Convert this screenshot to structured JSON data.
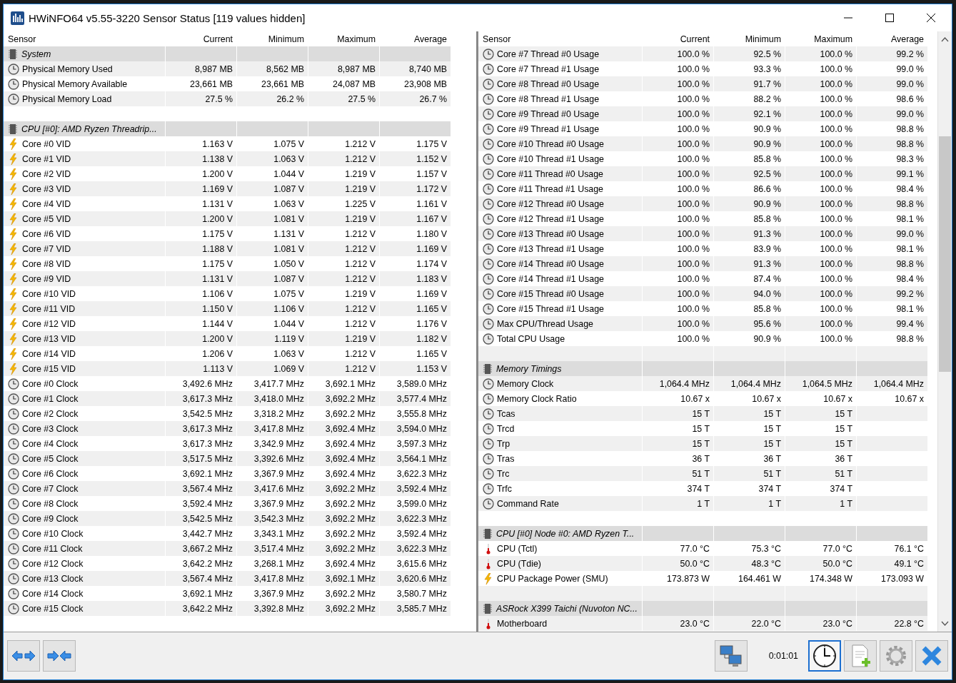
{
  "window": {
    "title": "HWiNFO64 v5.55-3220 Sensor Status [119 values hidden]"
  },
  "panes": [
    {
      "columns": [
        "Sensor",
        "Current",
        "Minimum",
        "Maximum",
        "Average"
      ],
      "first_row_shaded": false,
      "rows": [
        {
          "kind": "group",
          "label": "System"
        },
        {
          "kind": "clock",
          "label": "Physical Memory Used",
          "values": [
            "8,987 MB",
            "8,562 MB",
            "8,987 MB",
            "8,740 MB"
          ]
        },
        {
          "kind": "clock",
          "label": "Physical Memory Available",
          "values": [
            "23,661 MB",
            "23,661 MB",
            "24,087 MB",
            "23,908 MB"
          ]
        },
        {
          "kind": "clock",
          "label": "Physical Memory Load",
          "values": [
            "27.5 %",
            "26.2 %",
            "27.5 %",
            "26.7 %"
          ]
        },
        {
          "kind": "blank"
        },
        {
          "kind": "group",
          "label": "CPU [#0]: AMD Ryzen Threadrip..."
        },
        {
          "kind": "volt",
          "label": "Core #0 VID",
          "values": [
            "1.163 V",
            "1.075 V",
            "1.212 V",
            "1.175 V"
          ]
        },
        {
          "kind": "volt",
          "label": "Core #1 VID",
          "values": [
            "1.138 V",
            "1.063 V",
            "1.212 V",
            "1.152 V"
          ]
        },
        {
          "kind": "volt",
          "label": "Core #2 VID",
          "values": [
            "1.200 V",
            "1.044 V",
            "1.219 V",
            "1.157 V"
          ]
        },
        {
          "kind": "volt",
          "label": "Core #3 VID",
          "values": [
            "1.169 V",
            "1.087 V",
            "1.219 V",
            "1.172 V"
          ]
        },
        {
          "kind": "volt",
          "label": "Core #4 VID",
          "values": [
            "1.131 V",
            "1.063 V",
            "1.225 V",
            "1.161 V"
          ]
        },
        {
          "kind": "volt",
          "label": "Core #5 VID",
          "values": [
            "1.200 V",
            "1.081 V",
            "1.219 V",
            "1.167 V"
          ]
        },
        {
          "kind": "volt",
          "label": "Core #6 VID",
          "values": [
            "1.175 V",
            "1.131 V",
            "1.212 V",
            "1.180 V"
          ]
        },
        {
          "kind": "volt",
          "label": "Core #7 VID",
          "values": [
            "1.188 V",
            "1.081 V",
            "1.212 V",
            "1.169 V"
          ]
        },
        {
          "kind": "volt",
          "label": "Core #8 VID",
          "values": [
            "1.175 V",
            "1.050 V",
            "1.212 V",
            "1.174 V"
          ]
        },
        {
          "kind": "volt",
          "label": "Core #9 VID",
          "values": [
            "1.131 V",
            "1.087 V",
            "1.212 V",
            "1.183 V"
          ]
        },
        {
          "kind": "volt",
          "label": "Core #10 VID",
          "values": [
            "1.106 V",
            "1.075 V",
            "1.219 V",
            "1.169 V"
          ]
        },
        {
          "kind": "volt",
          "label": "Core #11 VID",
          "values": [
            "1.150 V",
            "1.106 V",
            "1.212 V",
            "1.165 V"
          ]
        },
        {
          "kind": "volt",
          "label": "Core #12 VID",
          "values": [
            "1.144 V",
            "1.044 V",
            "1.212 V",
            "1.176 V"
          ]
        },
        {
          "kind": "volt",
          "label": "Core #13 VID",
          "values": [
            "1.200 V",
            "1.119 V",
            "1.219 V",
            "1.182 V"
          ]
        },
        {
          "kind": "volt",
          "label": "Core #14 VID",
          "values": [
            "1.206 V",
            "1.063 V",
            "1.212 V",
            "1.165 V"
          ]
        },
        {
          "kind": "volt",
          "label": "Core #15 VID",
          "values": [
            "1.113 V",
            "1.069 V",
            "1.212 V",
            "1.153 V"
          ]
        },
        {
          "kind": "clock",
          "label": "Core #0 Clock",
          "values": [
            "3,492.6 MHz",
            "3,417.7 MHz",
            "3,692.1 MHz",
            "3,589.0 MHz"
          ]
        },
        {
          "kind": "clock",
          "label": "Core #1 Clock",
          "values": [
            "3,617.3 MHz",
            "3,418.0 MHz",
            "3,692.2 MHz",
            "3,577.4 MHz"
          ]
        },
        {
          "kind": "clock",
          "label": "Core #2 Clock",
          "values": [
            "3,542.5 MHz",
            "3,318.2 MHz",
            "3,692.2 MHz",
            "3,555.8 MHz"
          ]
        },
        {
          "kind": "clock",
          "label": "Core #3 Clock",
          "values": [
            "3,617.3 MHz",
            "3,417.8 MHz",
            "3,692.4 MHz",
            "3,594.0 MHz"
          ]
        },
        {
          "kind": "clock",
          "label": "Core #4 Clock",
          "values": [
            "3,617.3 MHz",
            "3,342.9 MHz",
            "3,692.4 MHz",
            "3,597.3 MHz"
          ]
        },
        {
          "kind": "clock",
          "label": "Core #5 Clock",
          "values": [
            "3,517.5 MHz",
            "3,392.6 MHz",
            "3,692.4 MHz",
            "3,564.1 MHz"
          ]
        },
        {
          "kind": "clock",
          "label": "Core #6 Clock",
          "values": [
            "3,692.1 MHz",
            "3,367.9 MHz",
            "3,692.4 MHz",
            "3,622.3 MHz"
          ]
        },
        {
          "kind": "clock",
          "label": "Core #7 Clock",
          "values": [
            "3,567.4 MHz",
            "3,417.6 MHz",
            "3,692.2 MHz",
            "3,592.4 MHz"
          ]
        },
        {
          "kind": "clock",
          "label": "Core #8 Clock",
          "values": [
            "3,592.4 MHz",
            "3,367.9 MHz",
            "3,692.2 MHz",
            "3,599.0 MHz"
          ]
        },
        {
          "kind": "clock",
          "label": "Core #9 Clock",
          "values": [
            "3,542.5 MHz",
            "3,542.3 MHz",
            "3,692.2 MHz",
            "3,622.3 MHz"
          ]
        },
        {
          "kind": "clock",
          "label": "Core #10 Clock",
          "values": [
            "3,442.7 MHz",
            "3,343.1 MHz",
            "3,692.2 MHz",
            "3,592.4 MHz"
          ]
        },
        {
          "kind": "clock",
          "label": "Core #11 Clock",
          "values": [
            "3,667.2 MHz",
            "3,517.4 MHz",
            "3,692.2 MHz",
            "3,622.3 MHz"
          ]
        },
        {
          "kind": "clock",
          "label": "Core #12 Clock",
          "values": [
            "3,642.2 MHz",
            "3,268.1 MHz",
            "3,692.4 MHz",
            "3,615.6 MHz"
          ]
        },
        {
          "kind": "clock",
          "label": "Core #13 Clock",
          "values": [
            "3,567.4 MHz",
            "3,417.8 MHz",
            "3,692.1 MHz",
            "3,620.6 MHz"
          ]
        },
        {
          "kind": "clock",
          "label": "Core #14 Clock",
          "values": [
            "3,692.1 MHz",
            "3,367.9 MHz",
            "3,692.2 MHz",
            "3,580.7 MHz"
          ]
        },
        {
          "kind": "clock",
          "label": "Core #15 Clock",
          "values": [
            "3,642.2 MHz",
            "3,392.8 MHz",
            "3,692.2 MHz",
            "3,585.7 MHz"
          ]
        },
        {
          "kind": "blank"
        }
      ]
    },
    {
      "columns": [
        "Sensor",
        "Current",
        "Minimum",
        "Maximum",
        "Average"
      ],
      "first_row_shaded": true,
      "rows": [
        {
          "kind": "clock",
          "label": "Core #7 Thread #0 Usage",
          "values": [
            "100.0 %",
            "92.5 %",
            "100.0 %",
            "99.2 %"
          ]
        },
        {
          "kind": "clock",
          "label": "Core #7 Thread #1 Usage",
          "values": [
            "100.0 %",
            "93.3 %",
            "100.0 %",
            "99.0 %"
          ]
        },
        {
          "kind": "clock",
          "label": "Core #8 Thread #0 Usage",
          "values": [
            "100.0 %",
            "91.7 %",
            "100.0 %",
            "99.0 %"
          ]
        },
        {
          "kind": "clock",
          "label": "Core #8 Thread #1 Usage",
          "values": [
            "100.0 %",
            "88.2 %",
            "100.0 %",
            "98.6 %"
          ]
        },
        {
          "kind": "clock",
          "label": "Core #9 Thread #0 Usage",
          "values": [
            "100.0 %",
            "92.1 %",
            "100.0 %",
            "99.0 %"
          ]
        },
        {
          "kind": "clock",
          "label": "Core #9 Thread #1 Usage",
          "values": [
            "100.0 %",
            "90.9 %",
            "100.0 %",
            "98.8 %"
          ]
        },
        {
          "kind": "clock",
          "label": "Core #10 Thread #0 Usage",
          "values": [
            "100.0 %",
            "90.9 %",
            "100.0 %",
            "98.8 %"
          ]
        },
        {
          "kind": "clock",
          "label": "Core #10 Thread #1 Usage",
          "values": [
            "100.0 %",
            "85.8 %",
            "100.0 %",
            "98.3 %"
          ]
        },
        {
          "kind": "clock",
          "label": "Core #11 Thread #0 Usage",
          "values": [
            "100.0 %",
            "92.5 %",
            "100.0 %",
            "99.1 %"
          ]
        },
        {
          "kind": "clock",
          "label": "Core #11 Thread #1 Usage",
          "values": [
            "100.0 %",
            "86.6 %",
            "100.0 %",
            "98.4 %"
          ]
        },
        {
          "kind": "clock",
          "label": "Core #12 Thread #0 Usage",
          "values": [
            "100.0 %",
            "90.9 %",
            "100.0 %",
            "98.8 %"
          ]
        },
        {
          "kind": "clock",
          "label": "Core #12 Thread #1 Usage",
          "values": [
            "100.0 %",
            "85.8 %",
            "100.0 %",
            "98.1 %"
          ]
        },
        {
          "kind": "clock",
          "label": "Core #13 Thread #0 Usage",
          "values": [
            "100.0 %",
            "91.3 %",
            "100.0 %",
            "99.0 %"
          ]
        },
        {
          "kind": "clock",
          "label": "Core #13 Thread #1 Usage",
          "values": [
            "100.0 %",
            "83.9 %",
            "100.0 %",
            "98.1 %"
          ]
        },
        {
          "kind": "clock",
          "label": "Core #14 Thread #0 Usage",
          "values": [
            "100.0 %",
            "91.3 %",
            "100.0 %",
            "98.8 %"
          ]
        },
        {
          "kind": "clock",
          "label": "Core #14 Thread #1 Usage",
          "values": [
            "100.0 %",
            "87.4 %",
            "100.0 %",
            "98.4 %"
          ]
        },
        {
          "kind": "clock",
          "label": "Core #15 Thread #0 Usage",
          "values": [
            "100.0 %",
            "94.0 %",
            "100.0 %",
            "99.2 %"
          ]
        },
        {
          "kind": "clock",
          "label": "Core #15 Thread #1 Usage",
          "values": [
            "100.0 %",
            "85.8 %",
            "100.0 %",
            "98.1 %"
          ]
        },
        {
          "kind": "clock",
          "label": "Max CPU/Thread Usage",
          "values": [
            "100.0 %",
            "95.6 %",
            "100.0 %",
            "99.4 %"
          ]
        },
        {
          "kind": "clock",
          "label": "Total CPU Usage",
          "values": [
            "100.0 %",
            "90.9 %",
            "100.0 %",
            "98.8 %"
          ]
        },
        {
          "kind": "blank"
        },
        {
          "kind": "group",
          "label": "Memory Timings"
        },
        {
          "kind": "clock",
          "label": "Memory Clock",
          "values": [
            "1,064.4 MHz",
            "1,064.4 MHz",
            "1,064.5 MHz",
            "1,064.4 MHz"
          ]
        },
        {
          "kind": "clock",
          "label": "Memory Clock Ratio",
          "values": [
            "10.67 x",
            "10.67 x",
            "10.67 x",
            "10.67 x"
          ]
        },
        {
          "kind": "clock",
          "label": "Tcas",
          "values": [
            "15 T",
            "15 T",
            "15 T"
          ]
        },
        {
          "kind": "clock",
          "label": "Trcd",
          "values": [
            "15 T",
            "15 T",
            "15 T"
          ]
        },
        {
          "kind": "clock",
          "label": "Trp",
          "values": [
            "15 T",
            "15 T",
            "15 T"
          ]
        },
        {
          "kind": "clock",
          "label": "Tras",
          "values": [
            "36 T",
            "36 T",
            "36 T"
          ]
        },
        {
          "kind": "clock",
          "label": "Trc",
          "values": [
            "51 T",
            "51 T",
            "51 T"
          ]
        },
        {
          "kind": "clock",
          "label": "Trfc",
          "values": [
            "374 T",
            "374 T",
            "374 T"
          ]
        },
        {
          "kind": "clock",
          "label": "Command Rate",
          "values": [
            "1 T",
            "1 T",
            "1 T"
          ]
        },
        {
          "kind": "blank"
        },
        {
          "kind": "group",
          "label": "CPU [#0] Node #0: AMD Ryzen T..."
        },
        {
          "kind": "temp",
          "label": "CPU (Tctl)",
          "values": [
            "77.0 °C",
            "75.3 °C",
            "77.0 °C",
            "76.1 °C"
          ]
        },
        {
          "kind": "temp",
          "label": "CPU (Tdie)",
          "values": [
            "50.0 °C",
            "48.3 °C",
            "50.0 °C",
            "49.1 °C"
          ]
        },
        {
          "kind": "volt",
          "label": "CPU Package Power (SMU)",
          "values": [
            "173.873 W",
            "164.461 W",
            "174.348 W",
            "173.093 W"
          ]
        },
        {
          "kind": "blank"
        },
        {
          "kind": "group",
          "label": "ASRock X399 Taichi (Nuvoton NC..."
        },
        {
          "kind": "temp",
          "label": "Motherboard",
          "values": [
            "23.0 °C",
            "22.0 °C",
            "23.0 °C",
            "22.8 °C"
          ]
        }
      ]
    }
  ],
  "toolbar": {
    "left": [
      {
        "kind": "expand",
        "active": false
      },
      {
        "kind": "collapse",
        "active": false
      }
    ],
    "right": [
      {
        "kind": "network",
        "active": false
      },
      {
        "kind": "timer",
        "text": "0:01:01"
      },
      {
        "kind": "clock",
        "active": true
      },
      {
        "kind": "report",
        "active": false
      },
      {
        "kind": "settings",
        "active": false
      },
      {
        "kind": "close",
        "active": false
      }
    ]
  }
}
